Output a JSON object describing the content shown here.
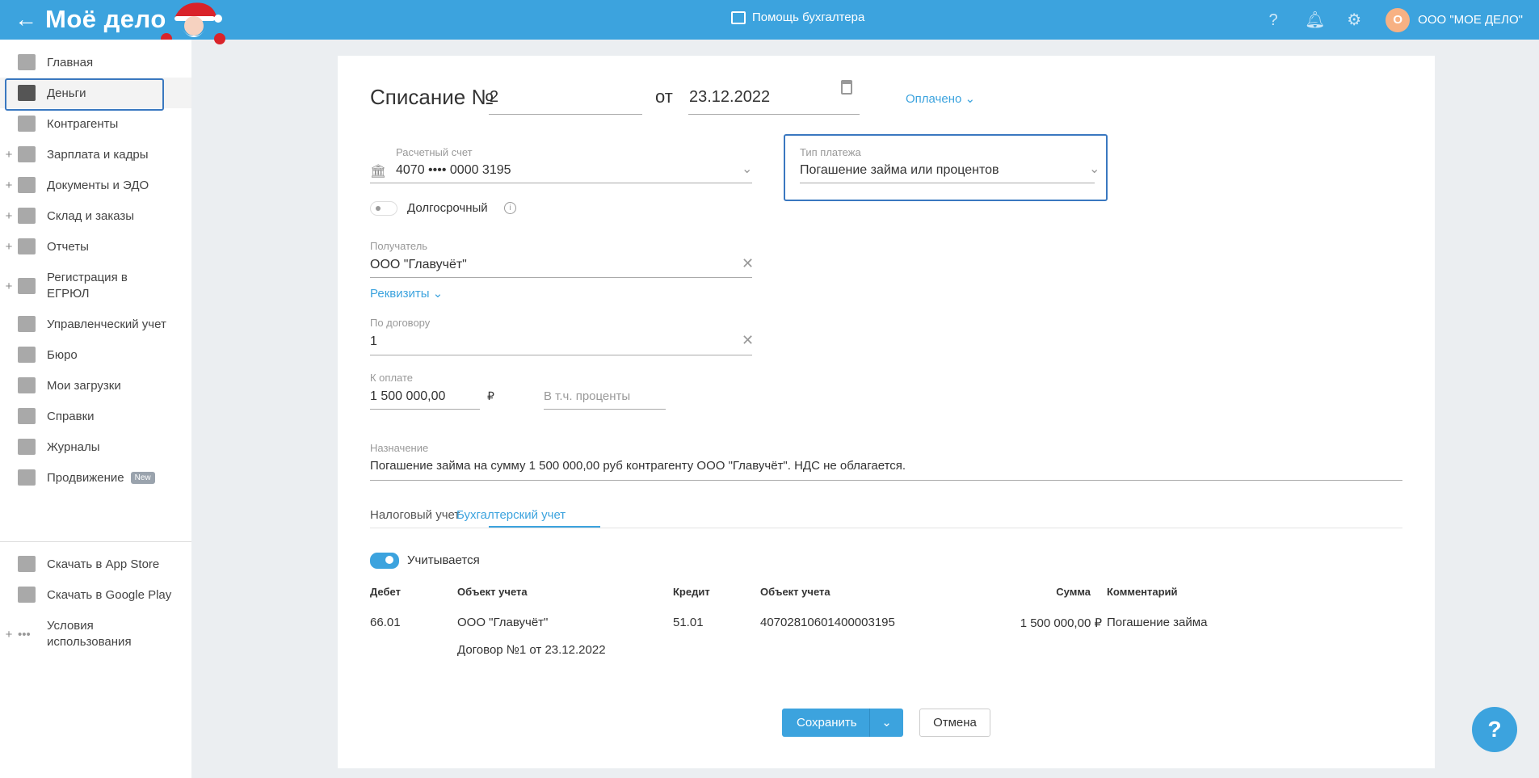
{
  "header": {
    "logo": "Моё дело",
    "center": "Помощь бухгалтера",
    "avatar_letter": "О",
    "org": "ООО \"МОЕ ДЕЛО\""
  },
  "sidebar": {
    "items": [
      {
        "label": "Главная",
        "plus": false
      },
      {
        "label": "Деньги",
        "plus": false,
        "active": true
      },
      {
        "label": "Контрагенты",
        "plus": false
      },
      {
        "label": "Зарплата и кадры",
        "plus": true
      },
      {
        "label": "Документы и ЭДО",
        "plus": true
      },
      {
        "label": "Склад и заказы",
        "plus": true
      },
      {
        "label": "Отчеты",
        "plus": true
      },
      {
        "label": "Регистрация в ЕГРЮЛ",
        "plus": true
      },
      {
        "label": "Управленческий учет",
        "plus": false
      },
      {
        "label": "Бюро",
        "plus": false
      },
      {
        "label": "Мои загрузки",
        "plus": false
      },
      {
        "label": "Справки",
        "plus": false
      },
      {
        "label": "Журналы",
        "plus": false
      },
      {
        "label": "Продвижение",
        "plus": false,
        "badge": "New"
      }
    ],
    "footer": [
      {
        "label": "Скачать в App Store"
      },
      {
        "label": "Скачать в Google Play"
      },
      {
        "label": "Условия использования"
      }
    ]
  },
  "form": {
    "title": "Списание №",
    "number": "2",
    "from": "от",
    "date": "23.12.2022",
    "status": "Оплачено",
    "account_label": "Расчетный счет",
    "account_value": "4070 •••• 0000 3195",
    "payment_type_label": "Тип платежа",
    "payment_type_value": "Погашение займа или процентов",
    "longterm_label": "Долгосрочный",
    "recipient_label": "Получатель",
    "recipient_value": "ООО \"Главучёт\"",
    "requisites_link": "Реквизиты",
    "contract_label": "По договору",
    "contract_value": "1",
    "amount_label": "К оплате",
    "amount_value": "1 500 000,00",
    "currency": "₽",
    "interest_placeholder": "В т.ч. проценты",
    "purpose_label": "Назначение",
    "purpose_value": "Погашение займа  на сумму 1 500 000,00 руб контрагенту ООО \"Главучёт\". НДС не облагается."
  },
  "tabs": [
    {
      "label": "Налоговый учет"
    },
    {
      "label": "Бухгалтерский учет",
      "active": true
    }
  ],
  "accounting": {
    "toggle_label": "Учитывается",
    "columns": [
      "Дебет",
      "Объект учета",
      "Кредит",
      "Объект учета",
      "Сумма",
      "Комментарий"
    ],
    "row": {
      "debit": "66.01",
      "debit_object": "ООО \"Главучёт\"",
      "debit_object2": "Договор №1 от 23.12.2022",
      "credit": "51.01",
      "credit_object": "40702810601400003195",
      "sum": "1 500 000,00 ₽",
      "comment": "Погашение займа"
    }
  },
  "buttons": {
    "save": "Сохранить",
    "cancel": "Отмена"
  },
  "colors": {
    "brand": "#3ca3de",
    "focus": "#3a78c0"
  }
}
